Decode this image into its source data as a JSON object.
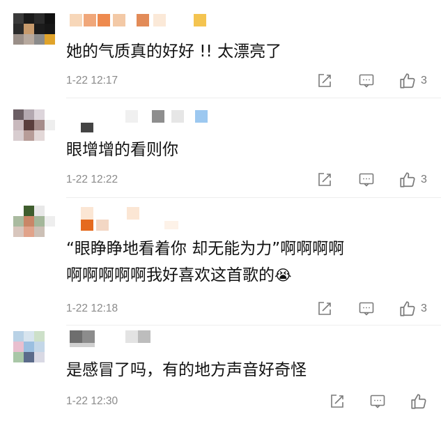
{
  "comments": [
    {
      "text": "她的气质真的好好 !! 太漂亮了",
      "time": "1-22 12:17",
      "likes": "3"
    },
    {
      "text": "眼增增的看则你",
      "time": "1-22 12:22",
      "likes": "3"
    },
    {
      "text_line1": "“眼睁睁地看着你 却无能为力”啊啊啊啊",
      "text_line2": "啊啊啊啊啊我好喜欢这首歌的",
      "emoji": "😭",
      "time": "1-22 12:18",
      "likes": "3"
    },
    {
      "text": "是感冒了吗，有的地方声音好奇怪",
      "time": "1-22 12:30",
      "likes": ""
    }
  ],
  "icons": {
    "forward": "forward-icon",
    "comment": "comment-icon",
    "like": "like-icon"
  },
  "colors": {
    "text": "#111111",
    "meta": "#8a8a8a",
    "icon": "#777777"
  }
}
